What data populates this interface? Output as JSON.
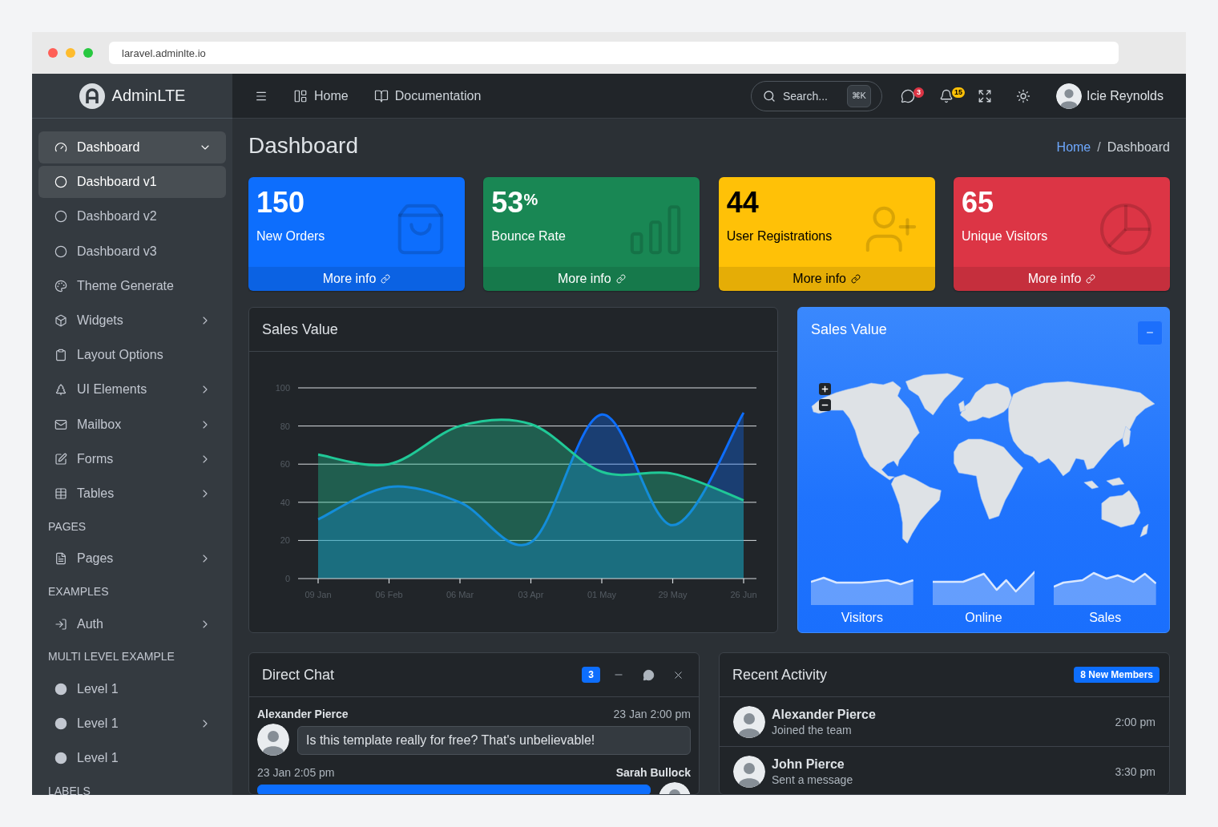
{
  "browser": {
    "dots": [
      {
        "color": "#ff5f57"
      },
      {
        "color": "#febc2e"
      },
      {
        "color": "#28c840"
      }
    ],
    "url": "laravel.adminlte.io"
  },
  "sidebar": {
    "brand": "AdminLTE",
    "sections": [
      {
        "items": [
          {
            "label": "Dashboard",
            "selected": true,
            "expanded": true,
            "children": [
              {
                "label": "Dashboard v1",
                "selected": true
              },
              {
                "label": "Dashboard v2",
                "selected": false
              },
              {
                "label": "Dashboard v3",
                "selected": false
              }
            ]
          },
          {
            "label": "Theme Generate",
            "selected": false
          },
          {
            "label": "Widgets",
            "selected": false,
            "expanded": false
          },
          {
            "label": "Layout Options",
            "selected": false
          },
          {
            "label": "UI Elements",
            "selected": false,
            "expanded": false
          },
          {
            "label": "Mailbox",
            "selected": false,
            "expanded": false
          },
          {
            "label": "Forms",
            "selected": false,
            "expanded": false
          },
          {
            "label": "Tables",
            "selected": false,
            "expanded": false
          }
        ]
      },
      {
        "header": "PAGES",
        "items": [
          {
            "label": "Pages",
            "selected": false,
            "expanded": false
          }
        ]
      },
      {
        "header": "EXAMPLES",
        "items": [
          {
            "label": "Auth",
            "selected": false,
            "expanded": false
          }
        ]
      },
      {
        "header": "MULTI LEVEL EXAMPLE",
        "items": [
          {
            "label": "Level 1",
            "selected": false
          },
          {
            "label": "Level 1",
            "selected": false,
            "expanded": false
          },
          {
            "label": "Level 1",
            "selected": false
          }
        ]
      },
      {
        "header": "LABELS"
      }
    ]
  },
  "navbar": {
    "links": [
      {
        "label": "Home"
      },
      {
        "label": "Documentation"
      }
    ],
    "search": {
      "placeholder": "Search...",
      "shortcut": "⌘K"
    },
    "tools": [
      {
        "kind": "messages",
        "badge": "3",
        "color": "#dc3545"
      },
      {
        "kind": "notifications",
        "badge": "15",
        "color": "#ffc107"
      },
      {
        "kind": "fullscreen"
      },
      {
        "kind": "theme"
      }
    ],
    "user": {
      "name": "Icie Reynolds"
    }
  },
  "content_header": {
    "title": "Dashboard",
    "separator": "/",
    "breadcrumb": [
      {
        "label": "Home",
        "selected": false
      },
      {
        "label": "Dashboard",
        "selected": true
      }
    ]
  },
  "info_boxes": [
    {
      "value": "150",
      "label": "New Orders",
      "link": "More info",
      "color": "#0d6efd"
    },
    {
      "value": "53$^{%}$",
      "label": "Bounce Rate",
      "link": "More info",
      "color": "#198754"
    },
    {
      "value": "44",
      "label": "User Registrations",
      "link": "More info",
      "color": "#ffc107"
    },
    {
      "value": "65",
      "label": "Unique Visitors",
      "link": "More info",
      "color": "#dc3545"
    }
  ],
  "sales_chart": {
    "title": "Sales Value",
    "chart_data": {
      "type": "area",
      "grid": true,
      "categories": [
        "09 Jan",
        "06 Feb",
        "06 Mar",
        "03 Apr",
        "01 May",
        "29 May",
        "26 Jun"
      ],
      "ylim": [
        0,
        100
      ],
      "yticks": [
        0,
        20,
        40,
        60,
        80,
        100
      ],
      "series": [
        {
          "color": "#0d6efd",
          "values": [
            31,
            48,
            40,
            19,
            86,
            28,
            87
          ]
        },
        {
          "color": "#20c997",
          "values": [
            65,
            60,
            80,
            81,
            56,
            55,
            41
          ]
        }
      ]
    }
  },
  "sales_map": {
    "title": "Sales Value",
    "sparklines": [
      {
        "label": "Visitors"
      },
      {
        "label": "Online"
      },
      {
        "label": "Sales"
      }
    ]
  },
  "direct_chat": {
    "title": "Direct Chat",
    "badge": "3",
    "messages": [
      {
        "kind": "received",
        "name": "Alexander Pierce",
        "time": "23 Jan 2:00 pm",
        "text": "Is this template really for free? That's unbelievable!"
      },
      {
        "kind": "sent",
        "name": "Sarah Bullock",
        "time": "23 Jan 2:05 pm"
      }
    ]
  },
  "recent_activity": {
    "title": "Recent Activity",
    "badge": "8 New Members",
    "items": [
      {
        "name": "Alexander Pierce",
        "action": "Joined the team",
        "time": "2:00 pm"
      },
      {
        "name": "John Pierce",
        "action": "Sent a message",
        "time": "3:30 pm"
      }
    ]
  }
}
